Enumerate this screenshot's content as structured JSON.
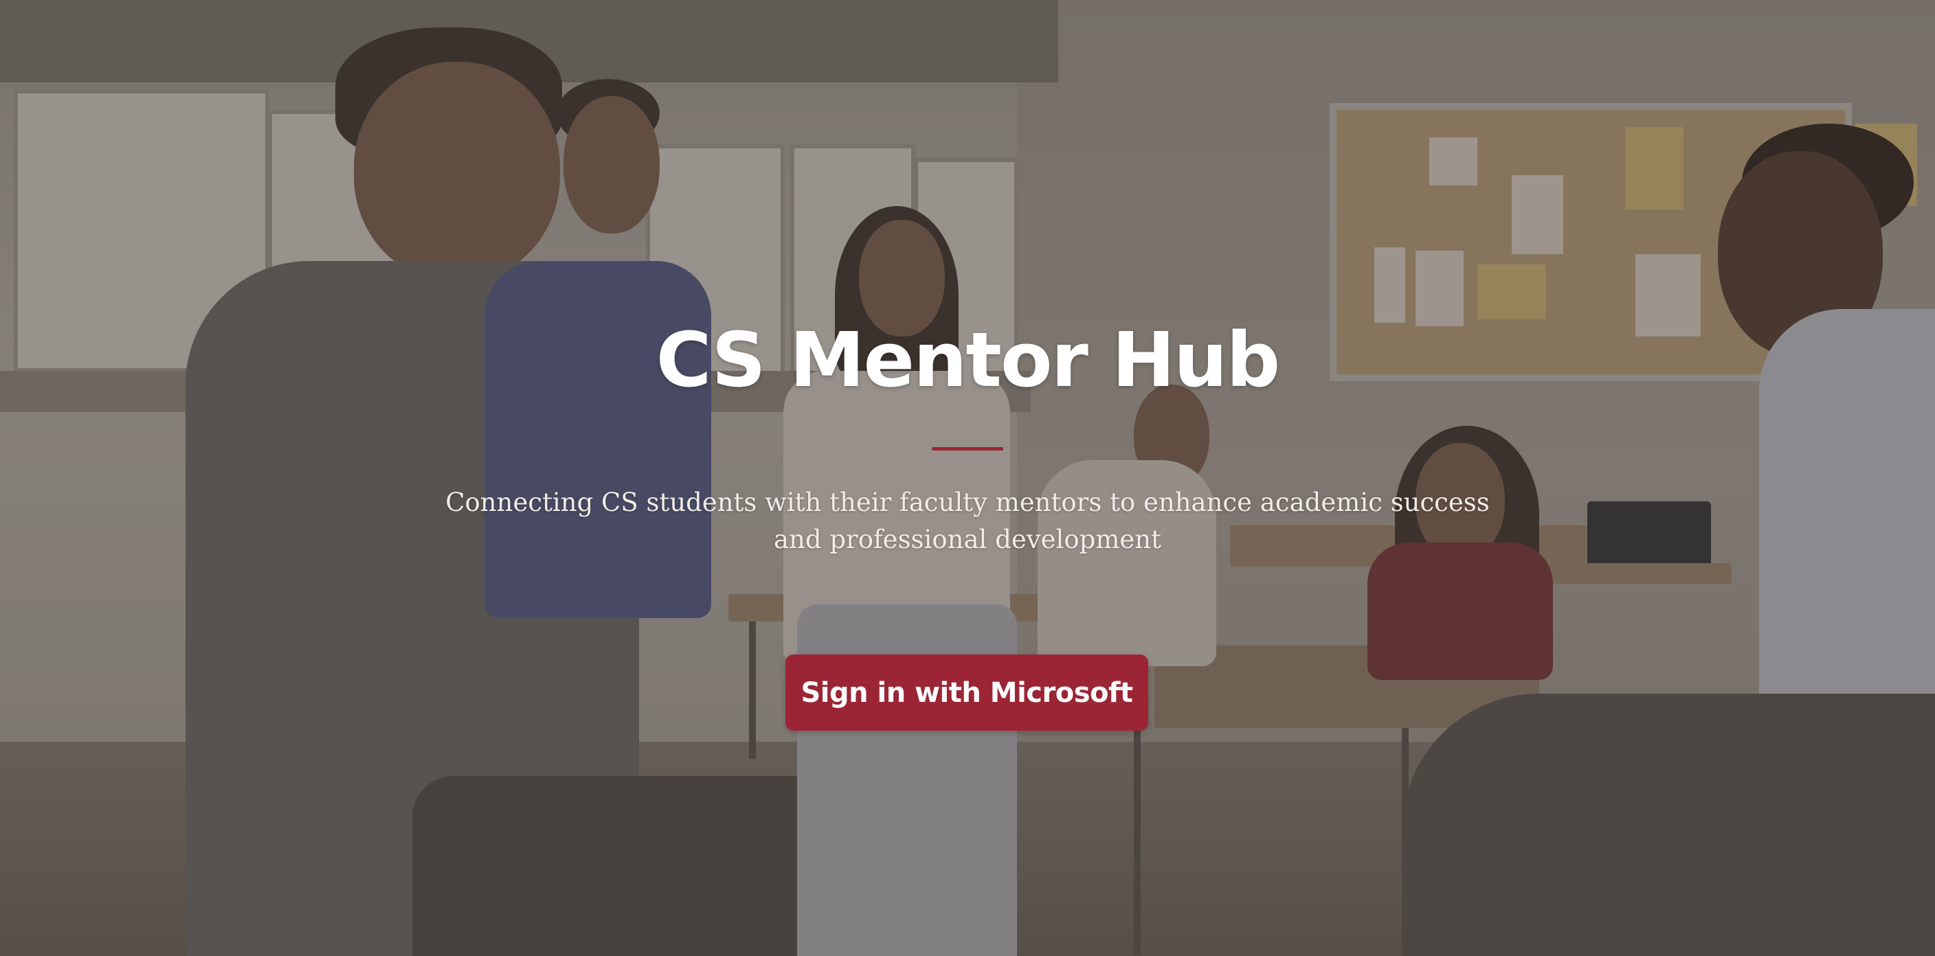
{
  "hero": {
    "title": "CS Mentor Hub",
    "subtitle": "Connecting CS students with their faculty mentors to enhance academic success and professional development",
    "signin_label": "Sign in with Microsoft"
  },
  "colors": {
    "accent": "#9b2535",
    "divider": "#9b2535",
    "title_text": "#ffffff"
  },
  "background": {
    "description_icon": "classroom-photo"
  }
}
